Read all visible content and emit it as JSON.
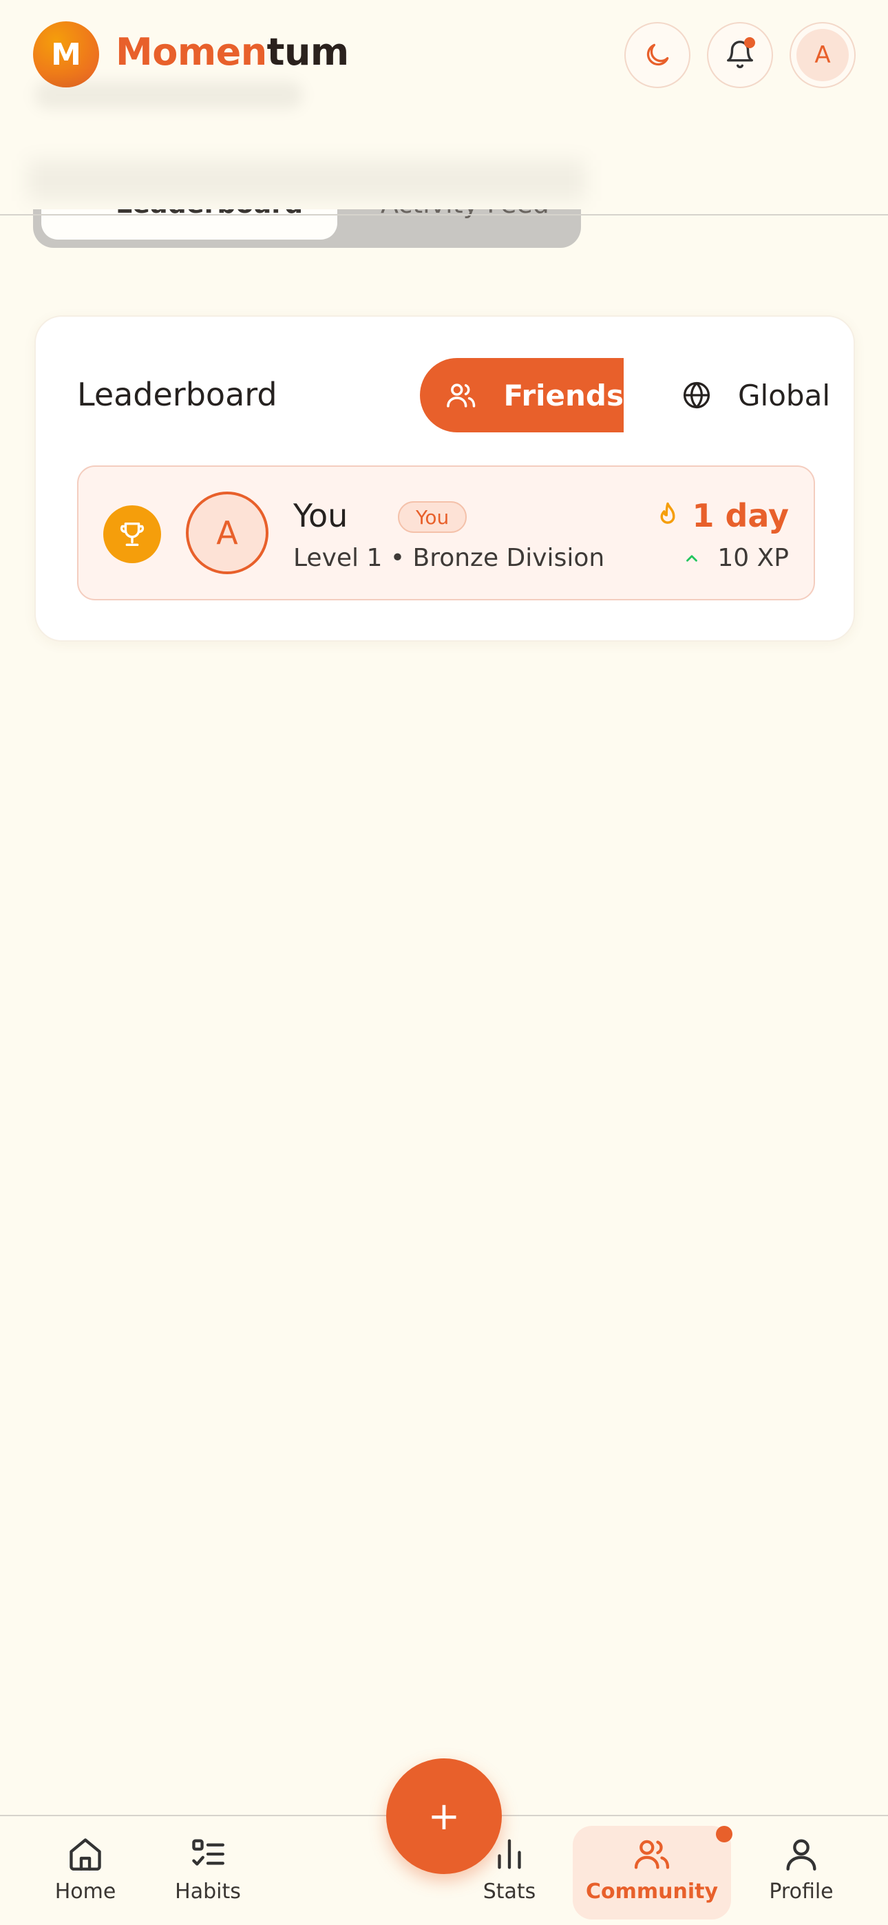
{
  "header": {
    "logo_letter": "M",
    "brand_part1": "Momen",
    "brand_part2": "tum",
    "avatar_letter": "A"
  },
  "tabs": [
    {
      "label": "Leaderboard"
    },
    {
      "label": "Activity Feed"
    }
  ],
  "leaderboard": {
    "title": "Leaderboard",
    "segments": [
      {
        "label": "Friends",
        "icon": "users-icon",
        "selected": true
      },
      {
        "label": "Global",
        "icon": "globe-icon",
        "selected": false
      }
    ],
    "entries": [
      {
        "avatar_letter": "A",
        "name": "You",
        "badge": "You",
        "subtitle": "Level 1 • Bronze Division",
        "streak": "1 day",
        "xp": "10 XP",
        "rank_icon": "trophy-icon"
      }
    ]
  },
  "nav": {
    "items": [
      {
        "label": "Home",
        "icon": "home-icon"
      },
      {
        "label": "Habits",
        "icon": "list-check-icon"
      },
      {
        "label": "Stats",
        "icon": "bar-chart-icon"
      },
      {
        "label": "Community",
        "icon": "users-icon",
        "active": true
      },
      {
        "label": "Profile",
        "icon": "user-icon"
      }
    ],
    "fab_label": "+"
  },
  "colors": {
    "accent": "#e8602b",
    "background": "#fefbf0",
    "trophy": "#f59e0b",
    "xp_up": "#22c55e"
  }
}
